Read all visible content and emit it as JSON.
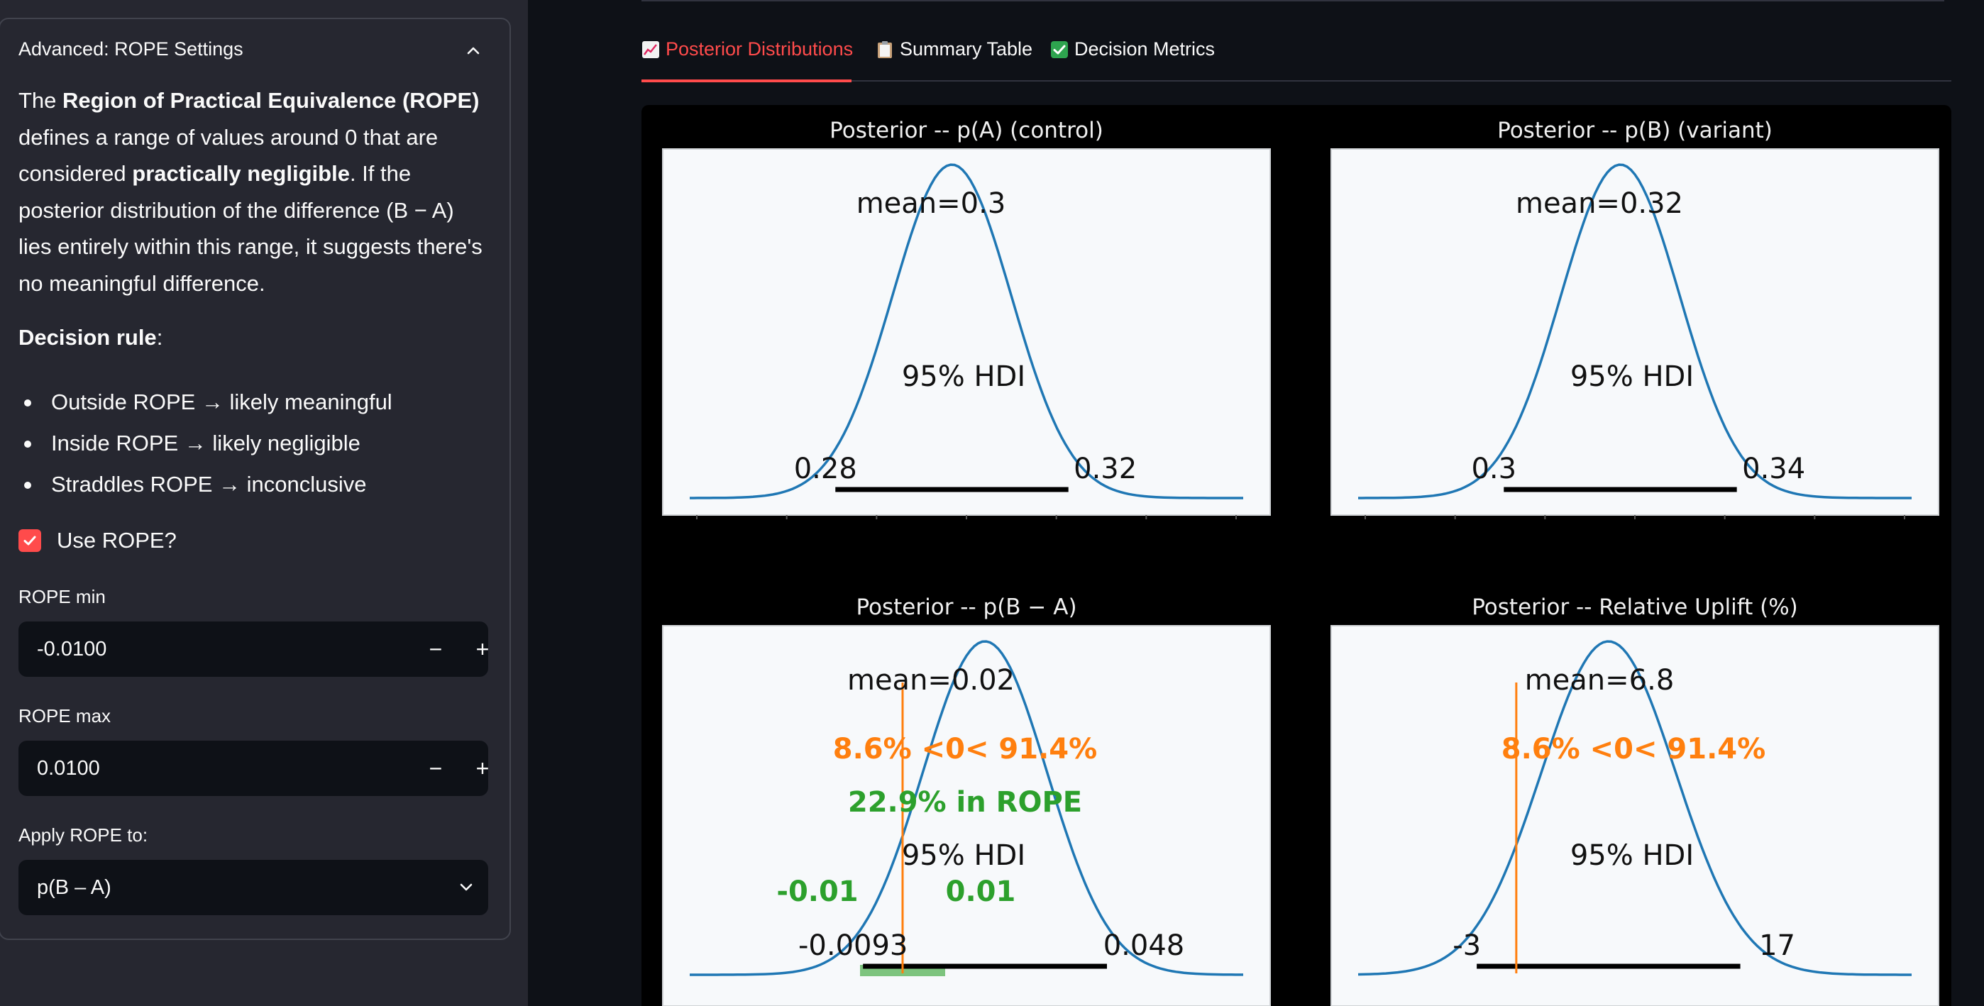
{
  "sidebar": {
    "expander_title": "Advanced: ROPE Settings",
    "description": {
      "p1": "The ",
      "b1": "Region of Practical Equivalence (ROPE)",
      "p2": " defines a range of values around 0 that are considered ",
      "b2": "practically negligible",
      "p3": ". If the posterior distribution of the difference (B − A) lies entirely within this range, it suggests there's no meaningful difference."
    },
    "decision_rule_label": "Decision rule",
    "decision_rule_colon": ":",
    "rules": [
      "Outside ROPE → likely meaningful",
      "Inside ROPE → likely negligible",
      "Straddles ROPE → inconclusive"
    ],
    "use_rope_label": "Use ROPE?",
    "use_rope_checked": true,
    "rope_min_label": "ROPE min",
    "rope_min_value": "-0.0100",
    "rope_max_label": "ROPE max",
    "rope_max_value": "0.0100",
    "apply_label": "Apply ROPE to:",
    "apply_value": "p(B – A)",
    "minus": "−",
    "plus": "+"
  },
  "tabs": [
    {
      "label": "Posterior Distributions",
      "icon": "chart-increasing-icon",
      "active": true
    },
    {
      "label": "Summary Table",
      "icon": "clipboard-icon",
      "active": false
    },
    {
      "label": "Decision Metrics",
      "icon": "check-mark-icon",
      "active": false
    }
  ],
  "colors": {
    "accent": "#ff4b4b",
    "curve": "#1f77b4",
    "prob": "#ff7f0e",
    "rope": "#2ca02c"
  },
  "chart_data": [
    {
      "type": "area",
      "title": "Posterior -- p(A) (control)",
      "mean_label": "mean=0.3",
      "hdi_label": "95% HDI",
      "hdi": [
        0.28,
        0.32
      ],
      "hdi_labels": [
        "0.28",
        "0.32"
      ],
      "xlim": [
        0.255,
        0.35
      ]
    },
    {
      "type": "area",
      "title": "Posterior -- p(B) (variant)",
      "mean_label": "mean=0.32",
      "hdi_label": "95% HDI",
      "hdi": [
        0.3,
        0.34
      ],
      "hdi_labels": [
        "0.3",
        "0.34"
      ],
      "xlim": [
        0.275,
        0.37
      ]
    },
    {
      "type": "area",
      "title": "Posterior -- p(B − A)",
      "mean_label": "mean=0.02",
      "hdi_label": "95% HDI",
      "hdi": [
        -0.0093,
        0.048
      ],
      "hdi_labels": [
        "-0.0093",
        "0.048"
      ],
      "ref_prob_label": "8.6% <0< 91.4%",
      "rope_label": "22.9% in ROPE",
      "rope": [
        -0.01,
        0.01
      ],
      "rope_labels": [
        "-0.01",
        "0.01"
      ],
      "xlim": [
        -0.05,
        0.08
      ]
    },
    {
      "type": "area",
      "title": "Posterior -- Relative Uplift (%)",
      "mean_label": "mean=6.8",
      "hdi_label": "95% HDI",
      "hdi": [
        -3,
        17
      ],
      "hdi_labels": [
        "-3",
        "17"
      ],
      "ref_prob_label": "8.6% <0< 91.4%",
      "xlim": [
        -12,
        30
      ]
    }
  ]
}
